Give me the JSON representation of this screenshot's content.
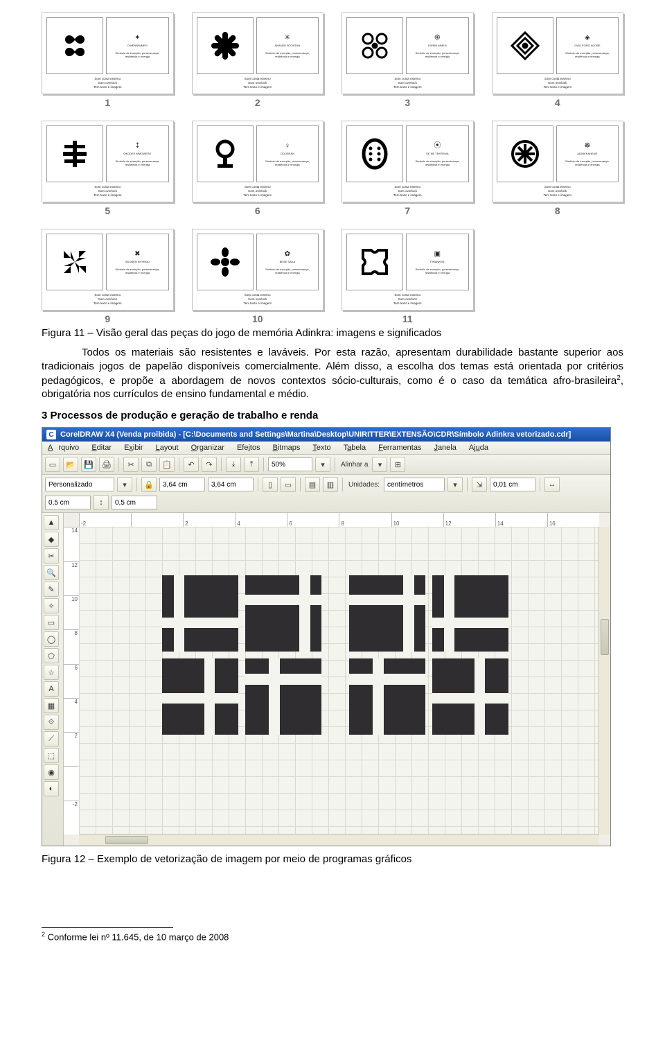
{
  "thumbs": {
    "caption_lines": [
      "Som conta externo",
      "Som overlock",
      "Tem texto e imagem"
    ],
    "right_desc": "Símbolo de exceção, perseverança, resiliência e energia",
    "items": [
      {
        "num": "1",
        "glyph": "dwennimmen",
        "name": "DWENNIMMEN"
      },
      {
        "num": "2",
        "glyph": "asterisk",
        "name": "ANANSE NTONTAN"
      },
      {
        "num": "3",
        "glyph": "spirals",
        "name": "DWENI MMEN"
      },
      {
        "num": "4",
        "glyph": "lozenge",
        "name": "OWO FORO ADOBE"
      },
      {
        "num": "5",
        "glyph": "stack",
        "name": "OKODEE MMOWERE"
      },
      {
        "num": "6",
        "glyph": "circle-stem",
        "name": "ODOSRAN"
      },
      {
        "num": "7",
        "glyph": "oval-grid",
        "name": "SE NE TEKREMA"
      },
      {
        "num": "8",
        "glyph": "wheel",
        "name": "ADINKRAHENE"
      },
      {
        "num": "9",
        "glyph": "fourblade",
        "name": "AKOBEN EKYEMU"
      },
      {
        "num": "10",
        "glyph": "flower",
        "name": "BESE SAKA"
      },
      {
        "num": "11",
        "glyph": "concave-sq",
        "name": "FIHANKRA"
      }
    ]
  },
  "fig11_caption": "Figura 11 – Visão geral das peças do jogo de memória Adinkra: imagens e significados",
  "body": {
    "p1": "Todos os materiais são resistentes e laváveis. Por esta razão, apresentam durabilidade bastante superior aos tradicionais jogos de papelão disponíveis comercialmente. Além disso, a escolha dos temas está orientada por critérios pedagógicos, e propõe a abordagem de novos contextos sócio-culturais, como é o caso da temática afro-brasileira",
    "p1_tail": ", obrigatória nos currículos de ensino fundamental e médio.",
    "sup": "2"
  },
  "section_title": "3 Processos de produção e geração de trabalho e renda",
  "cdr": {
    "title": "CorelDRAW X4 (Venda proibida) - [C:\\Documents and Settings\\Martina\\Desktop\\UNIRITTER\\EXTENSÃO\\CDR\\Símbolo Adinkra vetorizado.cdr]",
    "menu": [
      "Arquivo",
      "Editar",
      "Exibir",
      "Layout",
      "Organizar",
      "Efeitos",
      "Bitmaps",
      "Texto",
      "Tabela",
      "Ferramentas",
      "Janela",
      "Ajuda"
    ],
    "zoom": "50%",
    "alinhar": "Alinhar a",
    "prop": {
      "preset": "Personalizado",
      "w": "3,64 cm",
      "h": "3,64 cm",
      "units": "Unidades:",
      "units_val": "centímetros",
      "nudge": "0,01 cm",
      "dup_x": "0,5 cm",
      "dup_y": "0,5 cm"
    },
    "ruler_h": [
      "-2",
      "",
      "2",
      "4",
      "6",
      "8",
      "10",
      "12",
      "14",
      "16"
    ],
    "ruler_v": [
      "14",
      "12",
      "10",
      "8",
      "6",
      "4",
      "2",
      "",
      "-2"
    ]
  },
  "fig12_caption": "Figura 12 – Exemplo de vetorização de imagem por meio de programas gráficos",
  "footnote": {
    "num": "2",
    "text": " Conforme lei nº 11.645, de 10 março de 2008"
  }
}
